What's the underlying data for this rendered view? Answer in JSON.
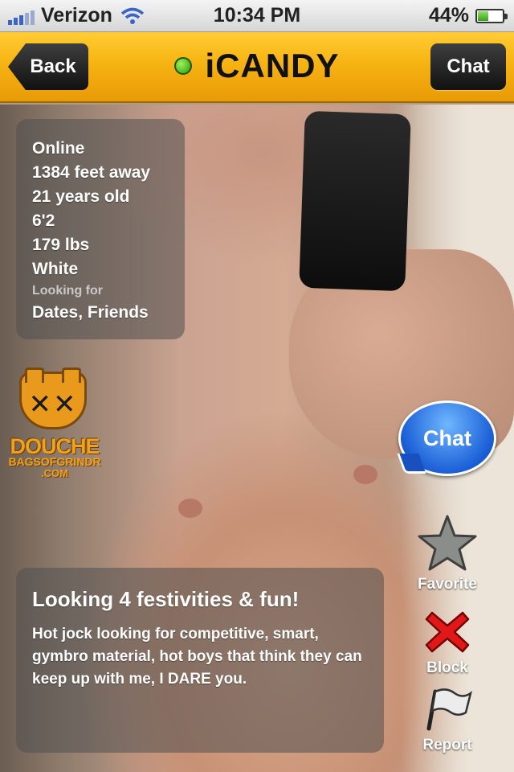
{
  "status_bar": {
    "carrier": "Verizon",
    "time": "10:34 PM",
    "battery_percent": "44%",
    "battery_level": 0.44
  },
  "nav": {
    "back_label": "Back",
    "title": "iCANDY",
    "chat_label": "Chat",
    "online_color": "#3fbf1a",
    "bar_color": "#f7b313"
  },
  "profile": {
    "status": "Online",
    "distance": "1384 feet away",
    "age": "21 years old",
    "height": "6'2",
    "weight": "179 lbs",
    "ethnicity": "White",
    "looking_for_label": "Looking for",
    "looking_for": "Dates, Friends"
  },
  "watermark": {
    "brand": "DOUCHE",
    "sub": "BAGSOFGRINDR",
    "domain": ".COM"
  },
  "actions": {
    "chat_bubble_label": "Chat",
    "favorite_label": "Favorite",
    "block_label": "Block",
    "report_label": "Report"
  },
  "bio": {
    "headline": "Looking 4 festivities & fun!",
    "text": "Hot jock looking for competitive, smart, gymbro material, hot boys that think they can keep up with me, I DARE you."
  },
  "icons": [
    "signal-icon",
    "wifi-icon",
    "battery-icon",
    "online-dot-icon",
    "star-icon",
    "x-icon",
    "flag-icon"
  ]
}
